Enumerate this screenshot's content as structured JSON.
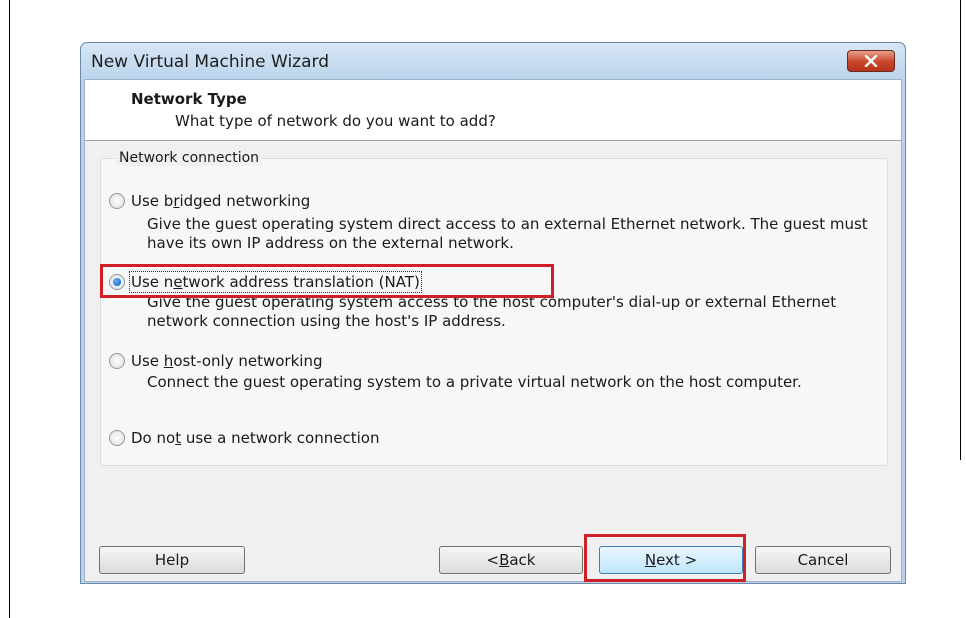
{
  "window": {
    "title": "New Virtual Machine Wizard"
  },
  "header": {
    "title": "Network Type",
    "subtitle": "What type of network do you want to add?"
  },
  "group": {
    "label": "Network connection"
  },
  "options": [
    {
      "pre": "Use b",
      "key": "r",
      "post": "idged networking",
      "desc": "Give the guest operating system direct access to an external Ethernet network. The guest must have its own IP address on the external network.",
      "checked": false
    },
    {
      "pre": "Use n",
      "key": "e",
      "post": "twork address translation (NAT)",
      "desc": "Give the guest operating system access to the host computer's dial-up or external Ethernet network connection using the host's IP address.",
      "checked": true
    },
    {
      "pre": "Use ",
      "key": "h",
      "post": "ost-only networking",
      "desc": "Connect the guest operating system to a private virtual network on the host computer.",
      "checked": false
    },
    {
      "pre": "Do no",
      "key": "t",
      "post": " use a network connection",
      "desc": "",
      "checked": false
    }
  ],
  "buttons": {
    "help": "Help",
    "back_pre": "< ",
    "back_key": "B",
    "back_post": "ack",
    "next_key": "N",
    "next_post": "ext >",
    "cancel": "Cancel"
  },
  "colors": {
    "highlight": "#d11f2a",
    "title_bar": "#c8dcf0"
  },
  "icons": {
    "close": "close-icon"
  }
}
